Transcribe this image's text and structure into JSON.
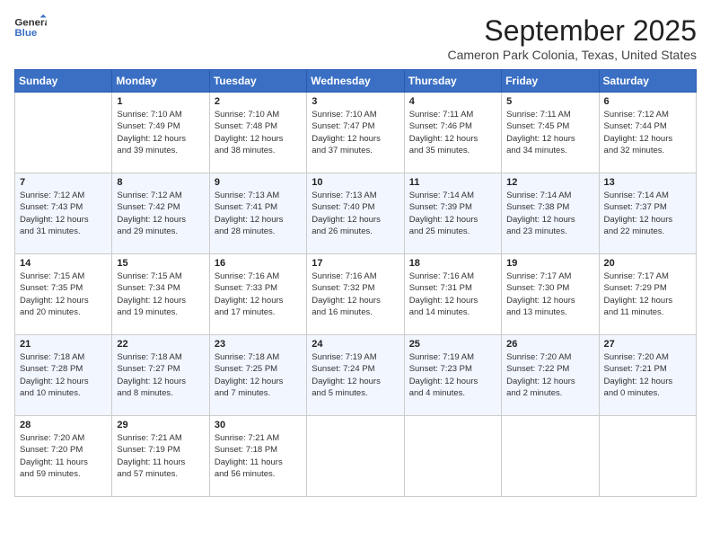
{
  "header": {
    "logo_line1": "General",
    "logo_line2": "Blue",
    "month": "September 2025",
    "location": "Cameron Park Colonia, Texas, United States"
  },
  "weekdays": [
    "Sunday",
    "Monday",
    "Tuesday",
    "Wednesday",
    "Thursday",
    "Friday",
    "Saturday"
  ],
  "weeks": [
    [
      {
        "day": "",
        "info": ""
      },
      {
        "day": "1",
        "info": "Sunrise: 7:10 AM\nSunset: 7:49 PM\nDaylight: 12 hours\nand 39 minutes."
      },
      {
        "day": "2",
        "info": "Sunrise: 7:10 AM\nSunset: 7:48 PM\nDaylight: 12 hours\nand 38 minutes."
      },
      {
        "day": "3",
        "info": "Sunrise: 7:10 AM\nSunset: 7:47 PM\nDaylight: 12 hours\nand 37 minutes."
      },
      {
        "day": "4",
        "info": "Sunrise: 7:11 AM\nSunset: 7:46 PM\nDaylight: 12 hours\nand 35 minutes."
      },
      {
        "day": "5",
        "info": "Sunrise: 7:11 AM\nSunset: 7:45 PM\nDaylight: 12 hours\nand 34 minutes."
      },
      {
        "day": "6",
        "info": "Sunrise: 7:12 AM\nSunset: 7:44 PM\nDaylight: 12 hours\nand 32 minutes."
      }
    ],
    [
      {
        "day": "7",
        "info": "Sunrise: 7:12 AM\nSunset: 7:43 PM\nDaylight: 12 hours\nand 31 minutes."
      },
      {
        "day": "8",
        "info": "Sunrise: 7:12 AM\nSunset: 7:42 PM\nDaylight: 12 hours\nand 29 minutes."
      },
      {
        "day": "9",
        "info": "Sunrise: 7:13 AM\nSunset: 7:41 PM\nDaylight: 12 hours\nand 28 minutes."
      },
      {
        "day": "10",
        "info": "Sunrise: 7:13 AM\nSunset: 7:40 PM\nDaylight: 12 hours\nand 26 minutes."
      },
      {
        "day": "11",
        "info": "Sunrise: 7:14 AM\nSunset: 7:39 PM\nDaylight: 12 hours\nand 25 minutes."
      },
      {
        "day": "12",
        "info": "Sunrise: 7:14 AM\nSunset: 7:38 PM\nDaylight: 12 hours\nand 23 minutes."
      },
      {
        "day": "13",
        "info": "Sunrise: 7:14 AM\nSunset: 7:37 PM\nDaylight: 12 hours\nand 22 minutes."
      }
    ],
    [
      {
        "day": "14",
        "info": "Sunrise: 7:15 AM\nSunset: 7:35 PM\nDaylight: 12 hours\nand 20 minutes."
      },
      {
        "day": "15",
        "info": "Sunrise: 7:15 AM\nSunset: 7:34 PM\nDaylight: 12 hours\nand 19 minutes."
      },
      {
        "day": "16",
        "info": "Sunrise: 7:16 AM\nSunset: 7:33 PM\nDaylight: 12 hours\nand 17 minutes."
      },
      {
        "day": "17",
        "info": "Sunrise: 7:16 AM\nSunset: 7:32 PM\nDaylight: 12 hours\nand 16 minutes."
      },
      {
        "day": "18",
        "info": "Sunrise: 7:16 AM\nSunset: 7:31 PM\nDaylight: 12 hours\nand 14 minutes."
      },
      {
        "day": "19",
        "info": "Sunrise: 7:17 AM\nSunset: 7:30 PM\nDaylight: 12 hours\nand 13 minutes."
      },
      {
        "day": "20",
        "info": "Sunrise: 7:17 AM\nSunset: 7:29 PM\nDaylight: 12 hours\nand 11 minutes."
      }
    ],
    [
      {
        "day": "21",
        "info": "Sunrise: 7:18 AM\nSunset: 7:28 PM\nDaylight: 12 hours\nand 10 minutes."
      },
      {
        "day": "22",
        "info": "Sunrise: 7:18 AM\nSunset: 7:27 PM\nDaylight: 12 hours\nand 8 minutes."
      },
      {
        "day": "23",
        "info": "Sunrise: 7:18 AM\nSunset: 7:25 PM\nDaylight: 12 hours\nand 7 minutes."
      },
      {
        "day": "24",
        "info": "Sunrise: 7:19 AM\nSunset: 7:24 PM\nDaylight: 12 hours\nand 5 minutes."
      },
      {
        "day": "25",
        "info": "Sunrise: 7:19 AM\nSunset: 7:23 PM\nDaylight: 12 hours\nand 4 minutes."
      },
      {
        "day": "26",
        "info": "Sunrise: 7:20 AM\nSunset: 7:22 PM\nDaylight: 12 hours\nand 2 minutes."
      },
      {
        "day": "27",
        "info": "Sunrise: 7:20 AM\nSunset: 7:21 PM\nDaylight: 12 hours\nand 0 minutes."
      }
    ],
    [
      {
        "day": "28",
        "info": "Sunrise: 7:20 AM\nSunset: 7:20 PM\nDaylight: 11 hours\nand 59 minutes."
      },
      {
        "day": "29",
        "info": "Sunrise: 7:21 AM\nSunset: 7:19 PM\nDaylight: 11 hours\nand 57 minutes."
      },
      {
        "day": "30",
        "info": "Sunrise: 7:21 AM\nSunset: 7:18 PM\nDaylight: 11 hours\nand 56 minutes."
      },
      {
        "day": "",
        "info": ""
      },
      {
        "day": "",
        "info": ""
      },
      {
        "day": "",
        "info": ""
      },
      {
        "day": "",
        "info": ""
      }
    ]
  ]
}
